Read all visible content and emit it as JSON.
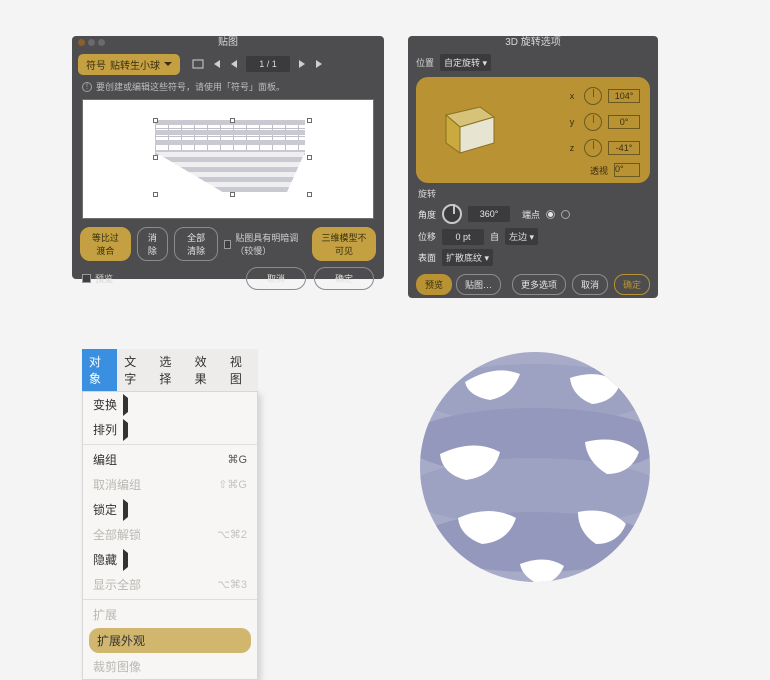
{
  "panel1": {
    "title": "贴图",
    "dropdown_label_prefix": "符号",
    "dropdown_selected": "贴转生小球",
    "page_indicator": "1 / 1",
    "tip_text": "要创建或编辑这些符号，请使用「符号」面板。",
    "btn_apply_fit": "等比过渡合",
    "btn_remove": "消除",
    "btn_remove_all": "全部清除",
    "chk_shaded": "贴图具有明暗调（较慢）",
    "btn_3d_invisible": "三维模型不可见",
    "chk_preview": "预览",
    "btn_cancel": "取消",
    "btn_ok": "确定"
  },
  "panel2": {
    "title": "3D 旋转选项",
    "position_label": "位置",
    "position_value": "自定旋转",
    "dial_x_label": "x",
    "dial_y_label": "y",
    "dial_z_label": "z",
    "val_x": "104°",
    "val_y": "0°",
    "val_z": "-41°",
    "persp_label": "透视",
    "persp_value": "0°",
    "section_rotate": "旋转",
    "angle_label": "角度",
    "angle_value": "360°",
    "cap_label": "端点",
    "offset_label": "位移",
    "offset_value": "0 pt",
    "from_label": "自",
    "from_value": "左边",
    "surface_label": "表面",
    "surface_value": "扩散底纹",
    "chk_preview": "预览",
    "btn_map": "贴图…",
    "btn_more": "更多选项",
    "btn_cancel": "取消",
    "btn_ok": "确定"
  },
  "panel3": {
    "tabs": {
      "t1": "对象",
      "t2": "文字",
      "t3": "选择",
      "t4": "效果",
      "t5": "视图"
    },
    "mi_transform": "变换",
    "mi_arrange": "排列",
    "mi_group": "编组",
    "mi_group_sc": "⌘G",
    "mi_ungroup": "取消编组",
    "mi_ungroup_sc": "⇧⌘G",
    "mi_lock": "锁定",
    "mi_unlockall": "全部解锁",
    "mi_unlockall_sc": "⌥⌘2",
    "mi_hide": "隐藏",
    "mi_showall": "显示全部",
    "mi_showall_sc": "⌥⌘3",
    "mi_expand": "扩展",
    "mi_expand_appear": "扩展外观",
    "mi_crop": "裁剪图像"
  }
}
